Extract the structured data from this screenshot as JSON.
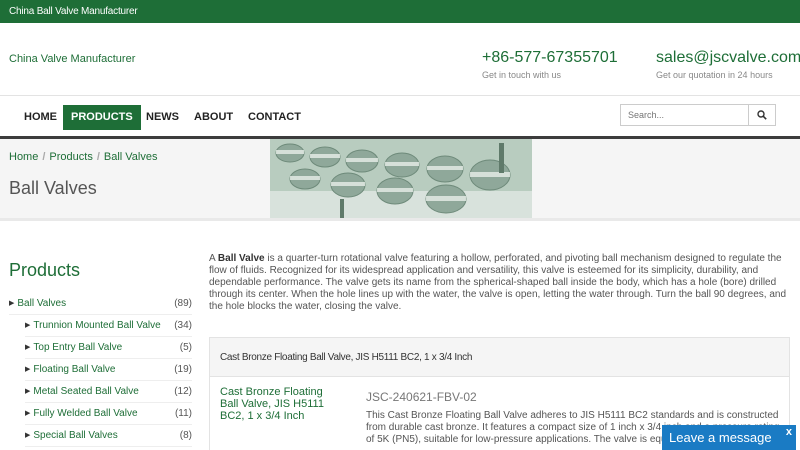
{
  "topbar": {
    "text": "China Ball Valve Manufacturer"
  },
  "header": {
    "brand": "China Valve Manufacturer",
    "phone": "+86-577-67355701",
    "phone_sub": "Get in touch with us",
    "email": "sales@jscvalve.com",
    "email_sub": "Get our quotation in 24 hours"
  },
  "nav": [
    {
      "label": "HOME"
    },
    {
      "label": "PRODUCTS",
      "active": true
    },
    {
      "label": "NEWS"
    },
    {
      "label": "ABOUT"
    },
    {
      "label": "CONTACT"
    }
  ],
  "search": {
    "placeholder": "Search..."
  },
  "breadcrumb": [
    "Home",
    "Products",
    "Ball Valves"
  ],
  "page_title": "Ball Valves",
  "sidebar": {
    "title": "Products",
    "categories": [
      {
        "label": "Ball Valves",
        "count": "(89)"
      },
      {
        "label": "Trunnion Mounted Ball Valve",
        "count": "(34)"
      },
      {
        "label": "Top Entry Ball Valve",
        "count": "(5)"
      },
      {
        "label": "Floating Ball Valve",
        "count": "(19)"
      },
      {
        "label": "Metal Seated Ball Valve",
        "count": "(12)"
      },
      {
        "label": "Fully Welded Ball Valve",
        "count": "(11)"
      },
      {
        "label": "Special Ball Valves",
        "count": "(8)"
      }
    ]
  },
  "intro": {
    "lead": "A ",
    "bold": "Ball Valve",
    "rest": " is a quarter-turn rotational valve featuring a hollow, perforated, and pivoting ball mechanism designed to regulate the flow of fluids. Recognized for its widespread application and versatility, this valve is esteemed for its simplicity, durability, and dependable performance. The valve gets its name from the spherical-shaped ball inside the body, which has a hole (bore) drilled through its center. When the hole lines up with the water, the valve is open, letting the water through. Turn the ball 90 degrees, and the hole blocks the water, closing the valve."
  },
  "product": {
    "heading": "Cast Bronze Floating Ball Valve, JIS H5111 BC2, 1 x 3/4 Inch",
    "name": "Cast Bronze Floating Ball Valve, JIS H5111 BC2, 1 x 3/4 Inch",
    "code": "JSC-240621-FBV-02",
    "desc": "This Cast Bronze Floating Ball Valve adheres to JIS H5111 BC2 standards and is constructed from durable cast bronze. It features a compact size of 1 inch x 3/4 inch and a pressure rating of 5K (PN5), suitable for low-pressure applications. The valve is equipped with a"
  },
  "chat": {
    "label": "Leave a message",
    "close": "x"
  },
  "colors": {
    "brand_green": "#1e6e37",
    "chat_blue": "#1a7bc4"
  }
}
